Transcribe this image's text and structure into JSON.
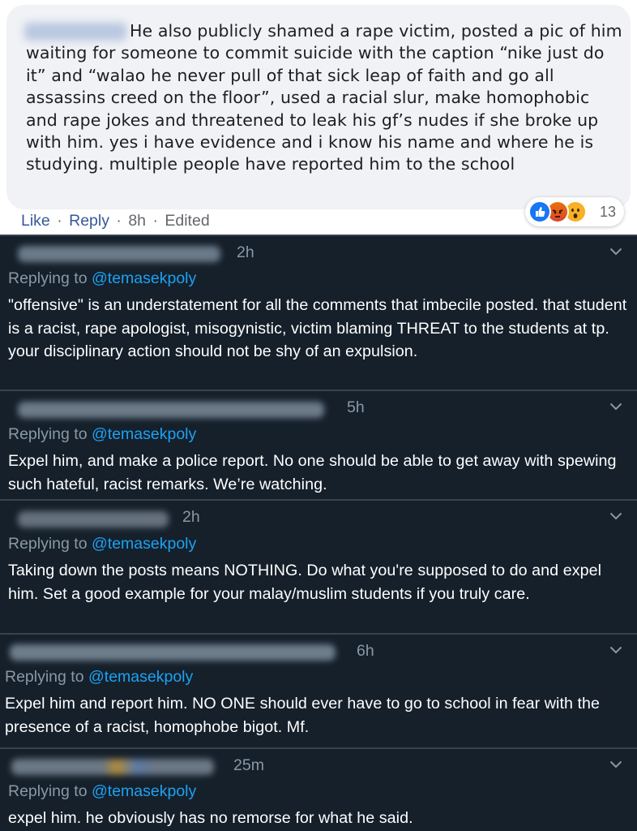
{
  "facebook_comment": {
    "text": "He also publicly shamed a rape victim, posted a pic of him waiting for someone to commit suicide with the caption “nike just do it” and “walao he never pull of that sick leap of faith and go all assassins creed on the floor”, used a racial slur, make homophobic and rape jokes and threatened to leak his gf’s nudes if she broke up with him. yes i have evidence and i know his name and where he is studying. multiple people have reported him to the school",
    "like_label": "Like",
    "reply_label": "Reply",
    "separator": "·",
    "time": "8h",
    "edited_label": "Edited",
    "reaction_count": "13",
    "reactions": [
      "like-icon",
      "angry-icon",
      "wow-icon"
    ]
  },
  "replies_prefix": "Replying to",
  "twitter_replies": [
    {
      "time": "2h",
      "handle": "@temasekpoly",
      "text": "\"offensive\" is an understatement for all the comments that imbecile posted. that student is a racist, rape apologist, misogynistic, victim blaming THREAT to the students at tp. your disciplinary action should not be shy of an expulsion."
    },
    {
      "time": "5h",
      "handle": "@temasekpoly",
      "text": "Expel him, and make a police report. No one should be able to get away with spewing such hateful, racist remarks. We’re watching."
    },
    {
      "time": "2h",
      "handle": "@temasekpoly",
      "text": "Taking down the posts means NOTHING. Do what you're supposed to do and expel him. Set a good example for your malay/muslim students if you truly care."
    },
    {
      "time": "6h",
      "handle": "@temasekpoly",
      "text": "Expel him and report him. NO ONE should ever have to go to school in fear with the presence of a racist, homophobe bigot. Mf."
    },
    {
      "time": "25m",
      "handle": "@temasekpoly",
      "text": "expel him. he obviously has no remorse for what he said."
    }
  ],
  "colors": {
    "twitter_bg": "#15202b",
    "twitter_link": "#1da1f2",
    "twitter_muted": "#8899a6",
    "facebook_link": "#385898"
  }
}
